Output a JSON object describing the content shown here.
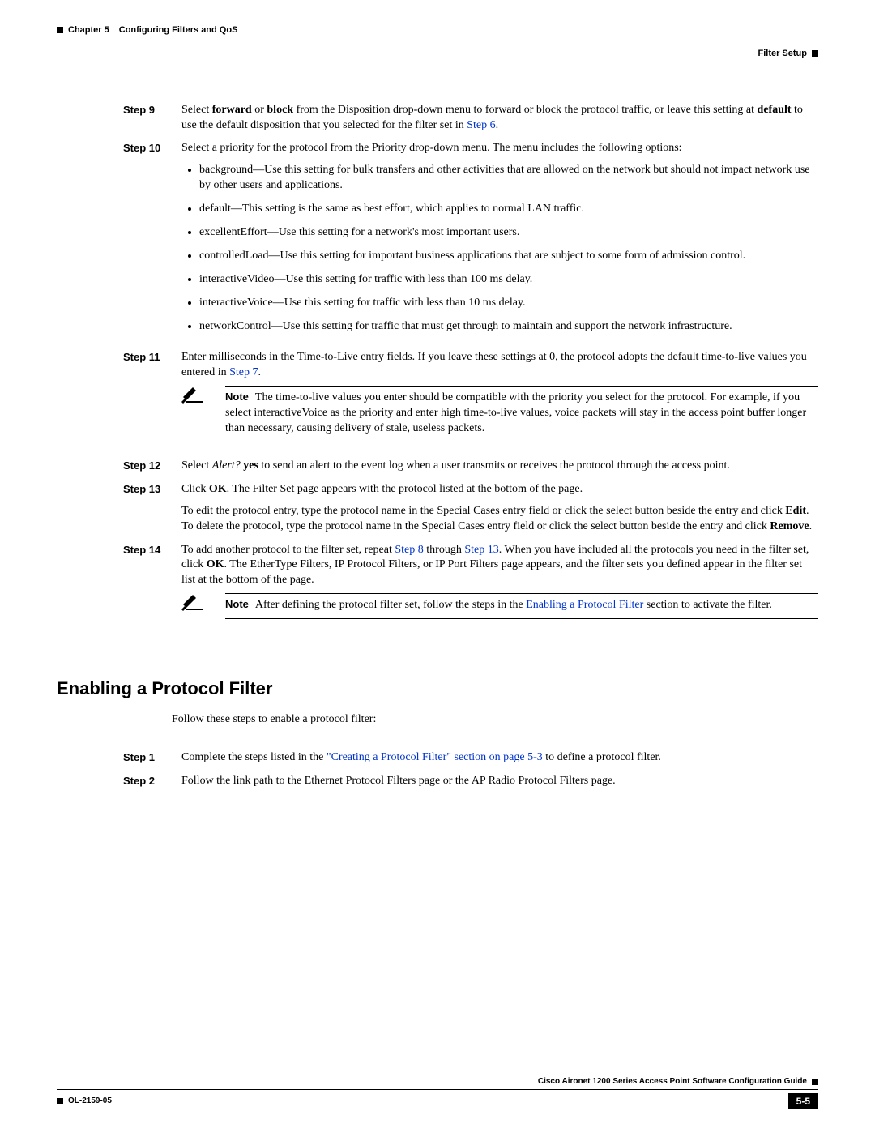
{
  "header": {
    "chapter": "Chapter 5",
    "chapter_title": "Configuring Filters and QoS",
    "section": "Filter Setup"
  },
  "steps_a": {
    "s9": {
      "label": "Step 9",
      "t1": "Select ",
      "b1": "forward",
      "t2": " or ",
      "b2": "block",
      "t3": " from the Disposition drop-down menu to forward or block the protocol traffic, or leave this setting at ",
      "b3": "default",
      "t4": " to use the default disposition that you selected for the filter set in ",
      "l1": "Step 6",
      "t5": "."
    },
    "s10": {
      "label": "Step 10",
      "intro": "Select a priority for the protocol from the Priority drop-down menu. The menu includes the following options:",
      "bul1": "background—Use this setting for bulk transfers and other activities that are allowed on the network but should not impact network use by other users and applications.",
      "bul2": "default—This setting is the same as best effort, which applies to normal LAN traffic.",
      "bul3": "excellentEffort—Use this setting for a network's most important users.",
      "bul4": "controlledLoad—Use this setting for important business applications that are subject to some form of admission control.",
      "bul5": "interactiveVideo—Use this setting for traffic with less than 100 ms delay.",
      "bul6": "interactiveVoice—Use this setting for traffic with less than 10 ms delay.",
      "bul7": "networkControl—Use this setting for traffic that must get through to maintain and support the network infrastructure."
    },
    "s11": {
      "label": "Step 11",
      "t1": "Enter milliseconds in the Time-to-Live entry fields. If you leave these settings at 0, the protocol adopts the default time-to-live values you entered in ",
      "l1": "Step 7",
      "t2": "."
    },
    "note1": {
      "label": "Note",
      "text": "The time-to-live values you enter should be compatible with the priority you select for the protocol. For example, if you select interactiveVoice as the priority and enter high time-to-live values, voice packets will stay in the access point buffer longer than necessary, causing delivery of stale, useless packets."
    },
    "s12": {
      "label": "Step 12",
      "t1": "Select ",
      "i1": "Alert?",
      "t2": " ",
      "b1": "yes",
      "t3": " to send an alert to the event log when a user transmits or receives the protocol through the access point."
    },
    "s13": {
      "label": "Step 13",
      "t1": "Click ",
      "b1": "OK",
      "t2": ". The Filter Set page appears with the protocol listed at the bottom of the page.",
      "p2a": "To edit the protocol entry, type the protocol name in the Special Cases entry field or click the select button beside the entry and click ",
      "p2b1": "Edit",
      "p2b": ". To delete the protocol, type the protocol name in the Special Cases entry field or click the select button beside the entry and click ",
      "p2b2": "Remove",
      "p2c": "."
    },
    "s14": {
      "label": "Step 14",
      "t1": "To add another protocol to the filter set, repeat ",
      "l1": "Step 8",
      "t2": " through ",
      "l2": "Step 13",
      "t3": ". When you have included all the protocols you need in the filter set, click ",
      "b1": "OK",
      "t4": ". The EtherType Filters, IP Protocol Filters, or IP Port Filters page appears, and the filter sets you defined appear in the filter set list at the bottom of the page."
    },
    "note2": {
      "label": "Note",
      "t1": "After defining the protocol filter set, follow the steps in the ",
      "l1": "Enabling a Protocol Filter",
      "t2": " section to activate the filter."
    }
  },
  "section2": {
    "title": "Enabling a Protocol Filter",
    "intro": "Follow these steps to enable a protocol filter:",
    "s1": {
      "label": "Step 1",
      "t1": "Complete the steps listed in the ",
      "l1": "\"Creating a Protocol Filter\" section on page 5-3",
      "t2": " to define a protocol filter."
    },
    "s2": {
      "label": "Step 2",
      "text": "Follow the link path to the Ethernet Protocol Filters page or the AP Radio Protocol Filters page."
    }
  },
  "footer": {
    "guide": "Cisco Aironet 1200 Series Access Point Software Configuration Guide",
    "doc": "OL-2159-05",
    "page": "5-5"
  }
}
